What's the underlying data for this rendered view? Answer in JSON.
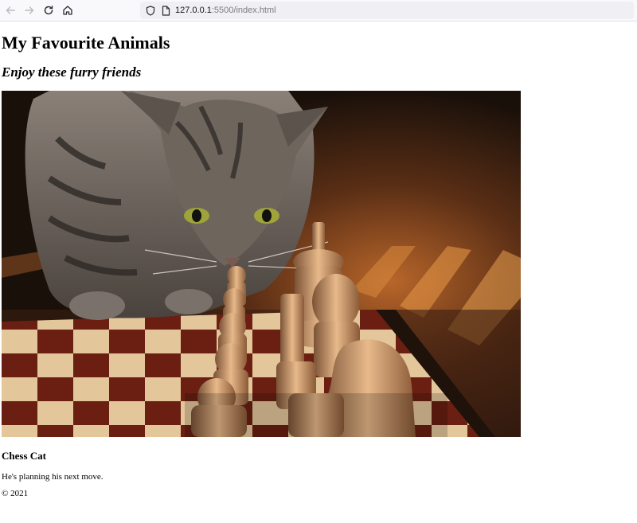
{
  "browser": {
    "url_host": "127.0.0.1",
    "url_rest": ":5500/index.html",
    "icons": {
      "back": "back-arrow-icon",
      "forward": "forward-arrow-icon",
      "reload": "reload-icon",
      "home": "home-icon",
      "shield": "shield-icon",
      "page": "page-icon"
    }
  },
  "page": {
    "title": "My Favourite Animals",
    "subtitle": "Enjoy these furry friends",
    "figure": {
      "caption_title": "Chess Cat",
      "caption_text": "He's planning his next move."
    },
    "footer": "© 2021"
  }
}
